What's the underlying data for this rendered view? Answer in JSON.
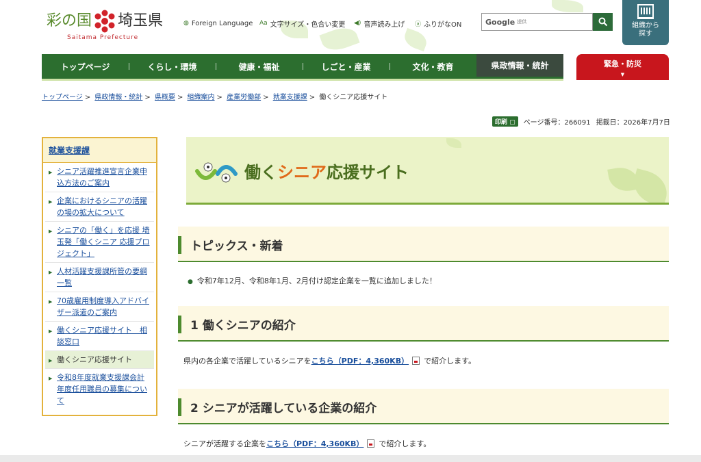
{
  "header": {
    "logo_jp_left": "彩の国",
    "logo_jp_right": "埼玉県",
    "logo_en": "Saitama Prefecture",
    "utilities": [
      {
        "icon": "globe-icon",
        "glyph": "◍",
        "label": "Foreign Language"
      },
      {
        "icon": "font-size-icon",
        "glyph": "Aa",
        "label": "文字サイズ・色合い変更"
      },
      {
        "icon": "speaker-icon",
        "glyph": "◀)",
        "label": "音声読み上げ"
      },
      {
        "icon": "furigana-icon",
        "glyph": "ⓐ",
        "label": "ふりがなON"
      }
    ],
    "search": {
      "brand": "Google",
      "brand_sub": "提供",
      "placeholder": ""
    },
    "org_button": "組織から探す"
  },
  "nav": {
    "items": [
      {
        "label": "トップページ"
      },
      {
        "label": "くらし・環境"
      },
      {
        "label": "健康・福祉"
      },
      {
        "label": "しごと・産業"
      },
      {
        "label": "文化・教育"
      },
      {
        "label": "県政情報・統計"
      }
    ],
    "emergency": "緊急・防災"
  },
  "breadcrumb": [
    "トップページ",
    "県政情報・統計",
    "県概要",
    "組織案内",
    "産業労働部",
    "就業支援課"
  ],
  "breadcrumb_current": "働くシニア応援サイト",
  "meta": {
    "print": "印刷",
    "page_number": "ページ番号：266091",
    "published": "掲載日：2026年7月7日"
  },
  "sidebar": {
    "title": "就業支援課",
    "items": [
      {
        "label": "シニア活躍推進宣言企業申込方法のご案内"
      },
      {
        "label": "企業におけるシニアの活躍の場の拡大について"
      },
      {
        "label": "シニアの「働く」を応援 埼玉発「働くシニア 応援プロジェクト」"
      },
      {
        "label": "人材活躍支援課所管の要綱一覧"
      },
      {
        "label": "70歳雇用制度導入アドバイザー派遣のご案内"
      },
      {
        "label": "働くシニア応援サイト　相談窓口"
      },
      {
        "label": "働くシニア応援サイト"
      },
      {
        "label": "令和8年度就業支援課会計年度任用職員の募集について"
      }
    ]
  },
  "banner": {
    "title_a": "働く",
    "title_b": "シニア",
    "title_c": "応援サイト"
  },
  "sections": [
    {
      "title": "トピックス・新着"
    },
    {
      "title": "1  働くシニアの紹介"
    },
    {
      "title": "2  シニアが活躍している企業の紹介"
    }
  ],
  "topics": {
    "item": "令和7年12月、令和8年1月、2月付け認定企業を一覧に追加しました！"
  },
  "section1": {
    "prefix": "県内の各企業で活躍しているシニアを",
    "link": "こちら（PDF：4,360KB）",
    "suffix": "で紹介します。"
  },
  "section2": {
    "prefix": "シニアが活躍する企業を",
    "link": "こちら（PDF：4,360KB）",
    "suffix": "で紹介します。"
  },
  "colors": {
    "nav_green": "#2c6e2f",
    "emergency_red": "#c8161d",
    "sidebar_border": "#e3b23c",
    "link_blue": "#1a4f9c"
  }
}
